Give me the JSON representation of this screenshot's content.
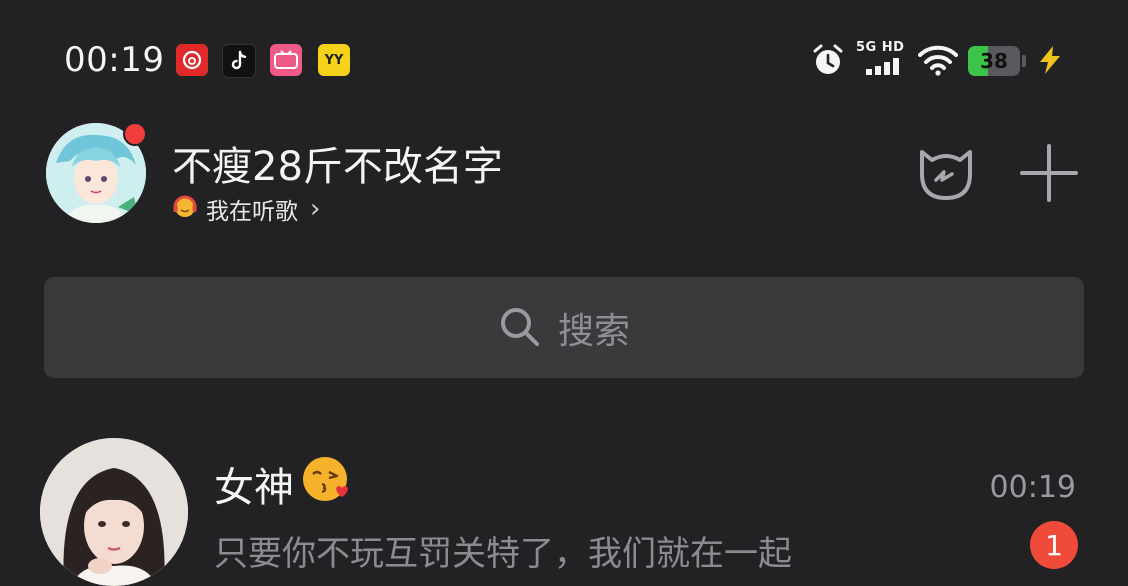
{
  "status_bar": {
    "time": "00:19",
    "network": "5G HD",
    "battery_level": "38",
    "app_icons": [
      "netease-music-icon",
      "tiktok-icon",
      "bilibili-icon",
      "yy-icon"
    ],
    "yy_label": "YY"
  },
  "header": {
    "username": "不瘦28斤不改名字",
    "status_text": "我在听歌",
    "status_chevron": "›",
    "has_unread_dot": true,
    "accent_red": "#f23d3d"
  },
  "search": {
    "placeholder": "搜索"
  },
  "conversations": [
    {
      "name": "女神",
      "emoji": "😘",
      "time": "00:19",
      "preview": "只要你不玩互罚关特了，我们就在一起",
      "unread_count": "1"
    }
  ]
}
